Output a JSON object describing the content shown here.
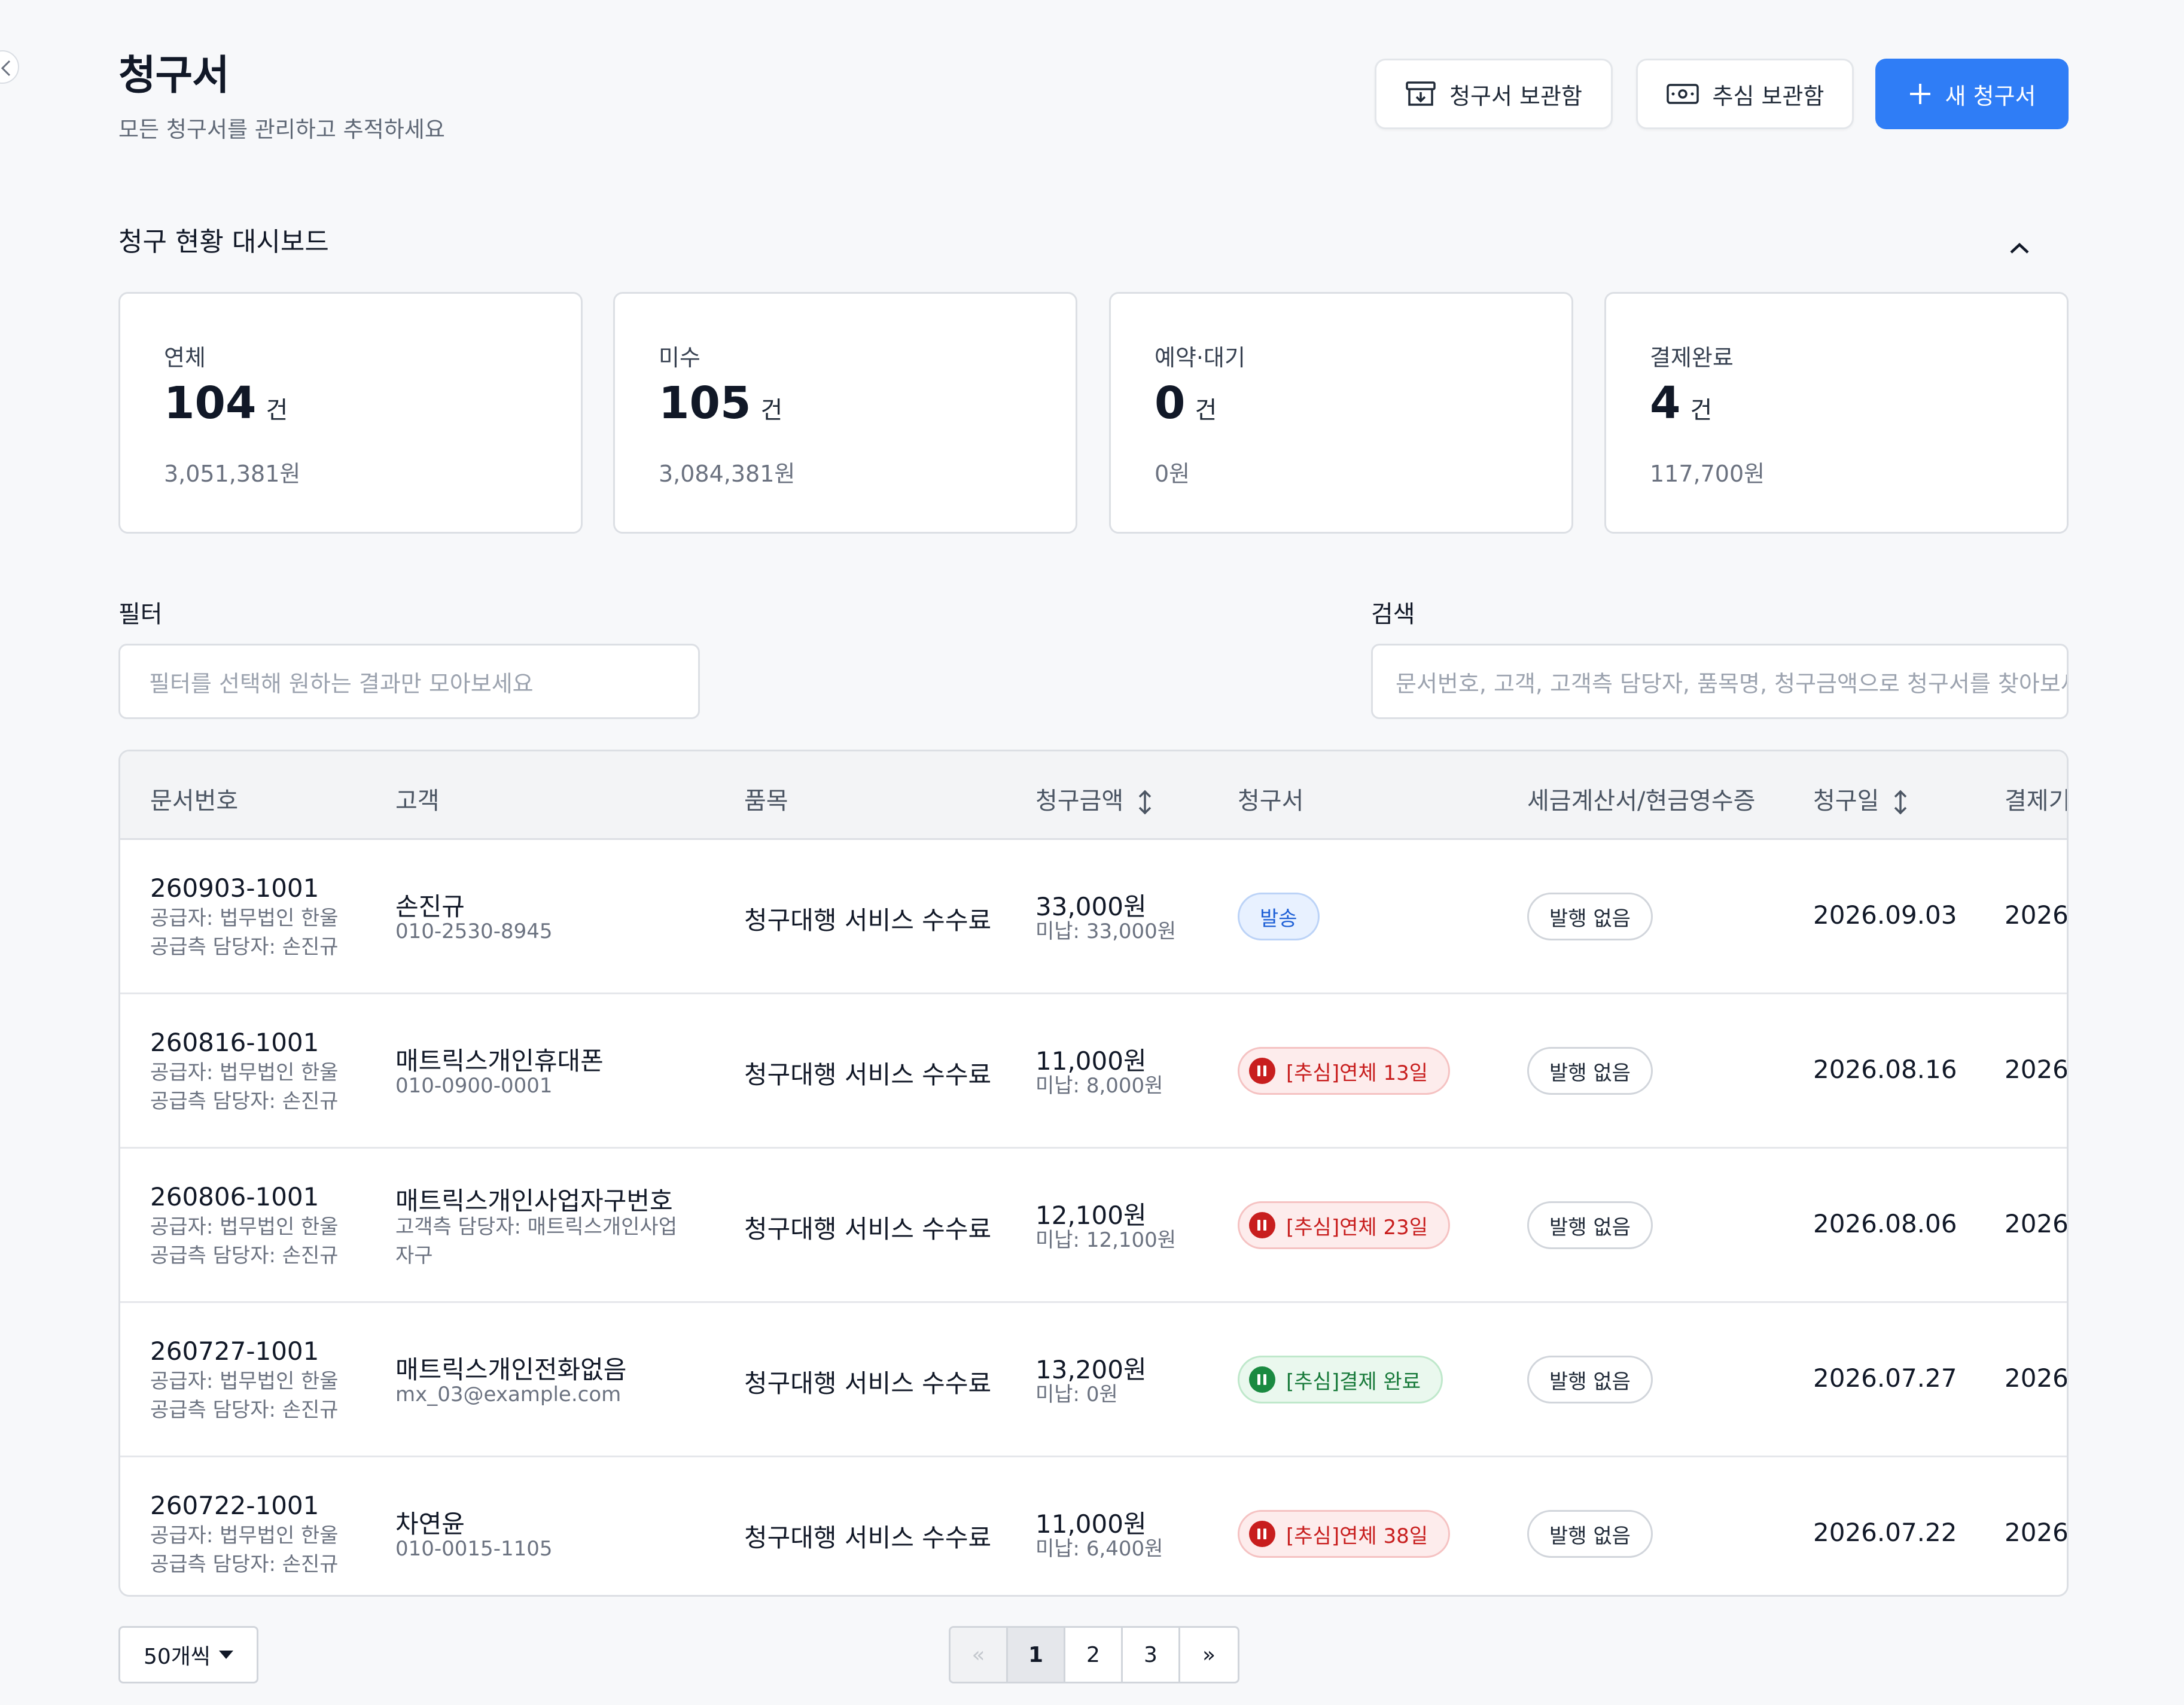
{
  "header": {
    "title": "청구서",
    "subtitle": "모든 청구서를 관리하고 추적하세요",
    "archive_button": "청구서 보관함",
    "collection_button": "추심 보관함",
    "new_button": "새 청구서"
  },
  "dashboard": {
    "title": "청구 현황 대시보드",
    "cards": [
      {
        "label": "연체",
        "count": "104",
        "unit": "건",
        "amount": "3,051,381원"
      },
      {
        "label": "미수",
        "count": "105",
        "unit": "건",
        "amount": "3,084,381원"
      },
      {
        "label": "예약·대기",
        "count": "0",
        "unit": "건",
        "amount": "0원"
      },
      {
        "label": "결제완료",
        "count": "4",
        "unit": "건",
        "amount": "117,700원"
      }
    ]
  },
  "filter": {
    "label": "필터",
    "placeholder": "필터를 선택해 원하는 결과만 모아보세요"
  },
  "search": {
    "label": "검색",
    "placeholder": "문서번호, 고객, 고객측 담당자, 품목명, 청구금액으로 청구서를 찾아보세요"
  },
  "table": {
    "columns": [
      "문서번호",
      "고객",
      "품목",
      "청구금액",
      "청구서",
      "세금계산서/현금영수증",
      "청구일",
      "결제기한"
    ],
    "rows": [
      {
        "doc_no": "260903-1001",
        "supplier": "공급자: 법무법인 한울",
        "supplier_contact": "공급측 담당자: 손진규",
        "customer": "손진규",
        "customer_sub": "010-2530-8945",
        "customer_sub2": "",
        "item": "청구대행 서비스 수수료",
        "amount": "33,000원",
        "unpaid": "미납: 33,000원",
        "status": "발송",
        "status_type": "sent",
        "tax": "발행 없음",
        "date": "2026.09.03",
        "due": "2026."
      },
      {
        "doc_no": "260816-1001",
        "supplier": "공급자: 법무법인 한울",
        "supplier_contact": "공급측 담당자: 손진규",
        "customer": "매트릭스개인휴대폰",
        "customer_sub": "010-0900-0001",
        "customer_sub2": "",
        "item": "청구대행 서비스 수수료",
        "amount": "11,000원",
        "unpaid": "미납: 8,000원",
        "status": "[추심]연체 13일",
        "status_type": "overdue",
        "tax": "발행 없음",
        "date": "2026.08.16",
        "due": "2026."
      },
      {
        "doc_no": "260806-1001",
        "supplier": "공급자: 법무법인 한울",
        "supplier_contact": "공급측 담당자: 손진규",
        "customer": "매트릭스개인사업자구번호",
        "customer_sub": "고객측 담당자: 매트릭스개인사업",
        "customer_sub2": "자구",
        "item": "청구대행 서비스 수수료",
        "amount": "12,100원",
        "unpaid": "미납: 12,100원",
        "status": "[추심]연체 23일",
        "status_type": "overdue",
        "tax": "발행 없음",
        "date": "2026.08.06",
        "due": "2026."
      },
      {
        "doc_no": "260727-1001",
        "supplier": "공급자: 법무법인 한울",
        "supplier_contact": "공급측 담당자: 손진규",
        "customer": "매트릭스개인전화없음",
        "customer_sub": "mx_03@example.com",
        "customer_sub2": "",
        "item": "청구대행 서비스 수수료",
        "amount": "13,200원",
        "unpaid": "미납: 0원",
        "status": "[추심]결제 완료",
        "status_type": "paid",
        "tax": "발행 없음",
        "date": "2026.07.27",
        "due": "2026."
      },
      {
        "doc_no": "260722-1001",
        "supplier": "공급자: 법무법인 한울",
        "supplier_contact": "공급측 담당자: 손진규",
        "customer": "차연윤",
        "customer_sub": "010-0015-1105",
        "customer_sub2": "",
        "item": "청구대행 서비스 수수료",
        "amount": "11,000원",
        "unpaid": "미납: 6,400원",
        "status": "[추심]연체 38일",
        "status_type": "overdue",
        "tax": "발행 없음",
        "date": "2026.07.22",
        "due": "2026."
      }
    ]
  },
  "pagination": {
    "per_page": "50개씩",
    "prev": "«",
    "pages": [
      "1",
      "2",
      "3"
    ],
    "next": "»",
    "current": "1"
  },
  "colors": {
    "primary": "#2f7df6",
    "overdue": "#c81e1e",
    "paid": "#1a8a41",
    "sent": "#1d5fd6"
  },
  "icons": {
    "archive": "archive-box-icon",
    "collection": "banknote-icon",
    "new": "plus-icon",
    "collapse": "chevron-up-icon",
    "sort": "sort-arrows-icon",
    "sidebar": "chevron-left-icon"
  }
}
